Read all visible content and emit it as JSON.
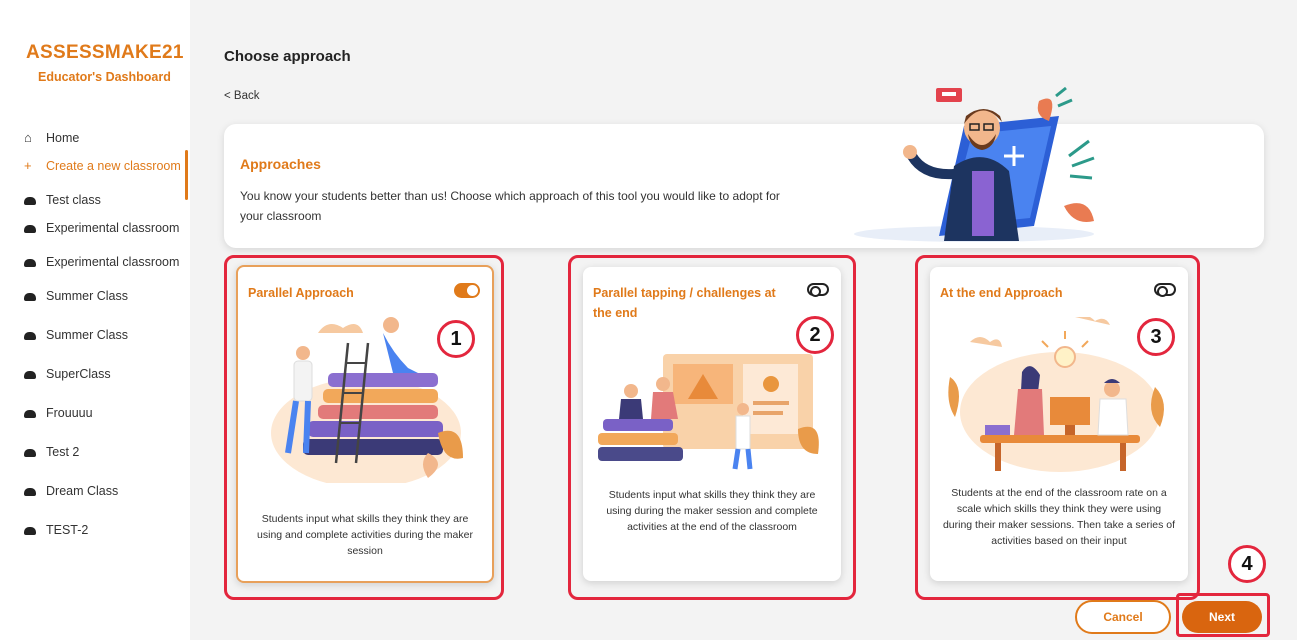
{
  "sidebar": {
    "brand": "ASSESSMAKE21",
    "subtitle": "Educator's Dashboard",
    "items": [
      {
        "label": "Home",
        "icon": "home-icon"
      },
      {
        "label": "Create a new classroom",
        "icon": "plus-icon",
        "active": true
      },
      {
        "label": "Test class",
        "icon": "car-icon"
      },
      {
        "label": "Experimental classroom",
        "icon": "car-icon"
      },
      {
        "label": "Experimental classroom",
        "icon": "car-icon"
      },
      {
        "label": "Summer Class",
        "icon": "car-icon"
      },
      {
        "label": "Summer Class",
        "icon": "car-icon"
      },
      {
        "label": "SuperClass",
        "icon": "car-icon"
      },
      {
        "label": "Frouuuu",
        "icon": "car-icon"
      },
      {
        "label": "Test 2",
        "icon": "car-icon"
      },
      {
        "label": "Dream Class",
        "icon": "car-icon"
      },
      {
        "label": "TEST-2",
        "icon": "car-icon"
      }
    ]
  },
  "main": {
    "title": "Choose approach",
    "back": "< Back",
    "approaches": {
      "title": "Approaches",
      "description": "You know your students better than us! Choose which approach of this tool you would like to adopt for your classroom"
    },
    "cards": [
      {
        "title": "Parallel Approach",
        "toggle": "on",
        "number": "1",
        "description": "Students input what skills they think they are using and complete activities during the maker session"
      },
      {
        "title": "Parallel tapping / challenges at the end",
        "toggle": "off",
        "number": "2",
        "description": "Students input what skills they think they are using during the maker session and complete activities at the end of the classroom"
      },
      {
        "title": "At the end Approach",
        "toggle": "off",
        "number": "3",
        "description": "Students at the end of the classroom rate on a scale which skills they think they were using during their maker sessions. Then take a series of activities based on their input"
      }
    ],
    "buttons": {
      "cancel": "Cancel",
      "next": "Next",
      "next_number": "4"
    }
  },
  "colors": {
    "accent": "#e07a1a",
    "annotation": "#e3263d",
    "next_button": "#d9650f"
  }
}
